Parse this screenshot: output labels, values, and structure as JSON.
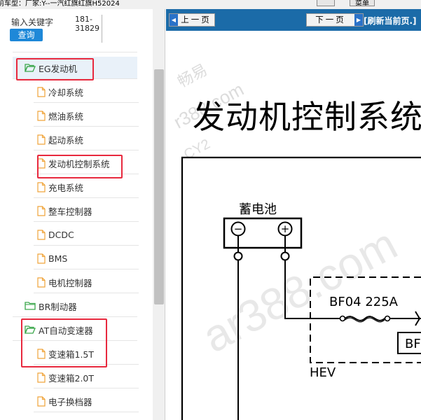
{
  "topbar": {
    "vehicle_info": "前车型：厂家:Y--一汽红旗红旗H52024",
    "btn_label": "菜单"
  },
  "search": {
    "label": "输入关键字",
    "button": "查询",
    "value_line1": "181-",
    "value_line2": "31829"
  },
  "tree": {
    "items": [
      {
        "label": "EG发动机",
        "icon": "folder-open-icon",
        "level": 1
      },
      {
        "label": "冷却系统",
        "icon": "file-icon",
        "level": 2
      },
      {
        "label": "燃油系统",
        "icon": "file-icon",
        "level": 2
      },
      {
        "label": "起动系统",
        "icon": "file-icon",
        "level": 2
      },
      {
        "label": "发动机控制系统",
        "icon": "file-icon",
        "level": 2
      },
      {
        "label": "充电系统",
        "icon": "file-icon",
        "level": 2
      },
      {
        "label": "整车控制器",
        "icon": "file-icon",
        "level": 2
      },
      {
        "label": "DCDC",
        "icon": "file-icon",
        "level": 2
      },
      {
        "label": "BMS",
        "icon": "file-icon",
        "level": 2
      },
      {
        "label": "电机控制器",
        "icon": "file-icon",
        "level": 2
      },
      {
        "label": "BR制动器",
        "icon": "folder-icon",
        "level": 1
      },
      {
        "label": "AT自动变速器",
        "icon": "folder-open-icon",
        "level": 1
      },
      {
        "label": "变速箱1.5T",
        "icon": "file-icon",
        "level": 2
      },
      {
        "label": "变速箱2.0T",
        "icon": "file-icon",
        "level": 2
      },
      {
        "label": "电子换档器",
        "icon": "file-icon",
        "level": 2
      }
    ]
  },
  "doc_toolbar": {
    "prev": "上一页",
    "next": "下一页",
    "refresh": "[刷新当前页.]"
  },
  "document": {
    "title": "发动机控制系统",
    "battery_label": "蓄电池",
    "battery_neg": "−",
    "battery_pos": "+",
    "fuse_label": "BF04 225A",
    "box_label": "HEV",
    "box_partial": "BF"
  },
  "watermarks": {
    "w1": "畅易",
    "w2": "r388.com",
    "w3": "CY2",
    "w4": "ar388.com"
  },
  "colors": {
    "highlight": "#e8293e",
    "toolbar_blue": "#1b6ba8",
    "search_button": "#1e88d8",
    "folder_green": "#3aa64a",
    "file_orange": "#f0a43a"
  }
}
